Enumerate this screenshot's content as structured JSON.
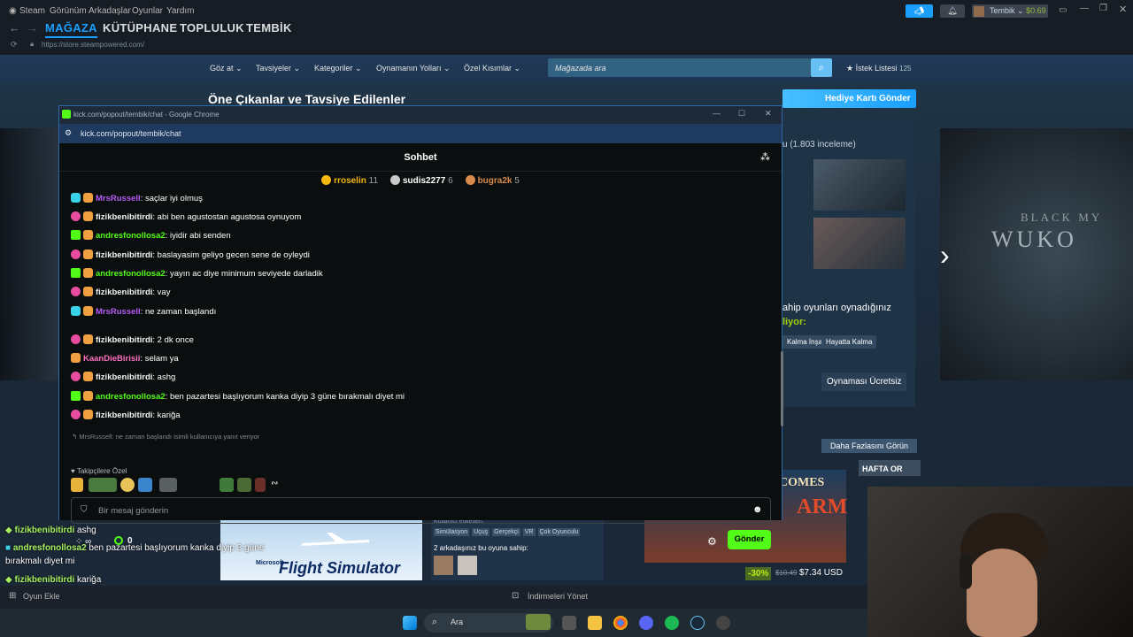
{
  "steam": {
    "menu": [
      "Steam",
      "Görünüm",
      "Arkadaşlar",
      "Oyunlar",
      "Yardım"
    ],
    "tabs": [
      "MAĞAZA",
      "KÜTÜPHANE",
      "TOPLULUK",
      "TEMBİK"
    ],
    "url": "https://store.steampowered.com/",
    "user": "Tembik",
    "balance": "$0.69",
    "store_nav": [
      "Göz at",
      "Tavsiyeler",
      "Kategoriler",
      "Oynamanın Yolları",
      "Özel Kısımlar"
    ],
    "search_placeholder": "Mağazada ara",
    "wishlist_label": "İstek Listesi",
    "wishlist_count": "125",
    "featured_title": "Öne Çıkanlar ve Tavsiye Edilenler",
    "gift_button": "Hediye Kartı Gönder",
    "reviews": "u (1.803 inceleme)",
    "owned_text": "ahip oyunları oynadığınız",
    "owned_text2": "liyor:",
    "tags": [
      "Kalma İnşa",
      "Hayatta Kalma"
    ],
    "free_label": "Oynaması Ücretsiz",
    "more_button": "Daha Fazlasını Görün",
    "hafta": "HAFTA OR",
    "hero_small": "BLACK MY",
    "hero_big": "WUKO",
    "fs_brand": "Microsoft",
    "fs_title": "Flight Simulator",
    "user_tags_label": "Kullanıcı etiketleri:",
    "user_tags": [
      "Simülasyon",
      "Uçuş",
      "Gerçekçi",
      "VR",
      "Çok Oyunculu"
    ],
    "friends_own": "2 arkadaşınız bu oyuna sahip:",
    "gom_line1": "COMES",
    "gom_line2": "ARM",
    "discount": "-30%",
    "old_price": "$10.49",
    "new_price": "$7.34 USD",
    "add_game": "Oyun Ekle",
    "downloads": "İndirmeleri Yönet"
  },
  "overlay_chat": [
    {
      "user": "fizikbenibitirdi",
      "text": "ashg"
    },
    {
      "user": "andresfonollosa2",
      "text": "ben pazartesi başlıyorum kanka diyip 3 güne"
    },
    {
      "user": "",
      "text": "bırakmalı diyet mi"
    },
    {
      "user": "fizikbenibitirdi",
      "text": "kariğa"
    }
  ],
  "taskbar": {
    "search": "Ara"
  },
  "chrome": {
    "title": "kick.com/popout/tembik/chat - Google Chrome",
    "url": "kick.com/popout/tembik/chat"
  },
  "kick": {
    "header": "Sohbet",
    "leaders": [
      {
        "name": "rroselin",
        "count": "11",
        "color": "#f5b80f"
      },
      {
        "name": "sudis2277",
        "count": "6",
        "color": "#c9c9c9"
      },
      {
        "name": "bugra2k",
        "count": "5",
        "color": "#d98a4a"
      }
    ],
    "messages": [
      {
        "badge": "b-wave",
        "user": "MrsRussell",
        "cls": "u-purple",
        "text": "saçlar iyi olmuş"
      },
      {
        "badge": "b-pink",
        "user": "fizikbenibitirdi",
        "cls": "u-white",
        "text": "abi ben agustostan agustosa oynuyom"
      },
      {
        "badge": "b-tw",
        "user": "andresfonollosa2",
        "cls": "u-green",
        "text": "iyidir abi senden"
      },
      {
        "badge": "b-pink",
        "user": "fizikbenibitirdi",
        "cls": "u-white",
        "text": "baslayasim geliyo gecen sene de oyleydi"
      },
      {
        "badge": "b-tw",
        "user": "andresfonollosa2",
        "cls": "u-green",
        "text": "yayın ac diye minimum seviyede darladik"
      },
      {
        "badge": "b-pink",
        "user": "fizikbenibitirdi",
        "cls": "u-white",
        "text": "vay"
      },
      {
        "badge": "b-wave",
        "user": "MrsRussell",
        "cls": "u-purple",
        "text": "ne zaman başlandı"
      },
      {
        "badge": "b-pink",
        "user": "fizikbenibitirdi",
        "cls": "u-white",
        "text": "2 dk once"
      },
      {
        "badge": "",
        "user": "KaanDieBirisii",
        "cls": "u-pink",
        "text": "selam ya"
      },
      {
        "badge": "b-pink",
        "user": "fizikbenibitirdi",
        "cls": "u-white",
        "text": "ashg"
      },
      {
        "badge": "b-tw",
        "user": "andresfonollosa2",
        "cls": "u-green",
        "text": "ben pazartesi başlıyorum kanka diyip 3 güne bırakmalı diyet mi"
      },
      {
        "badge": "b-pink",
        "user": "fizikbenibitirdi",
        "cls": "u-white",
        "text": "kariğa"
      }
    ],
    "reply_line": "MrsRussell: ne zaman başlandı isimli kullanıcıya yanıt veriyor",
    "fav_label": "Takipçilere Özel",
    "input_placeholder": "Bir mesaj gönderin",
    "points": "0",
    "send": "Gönder"
  }
}
